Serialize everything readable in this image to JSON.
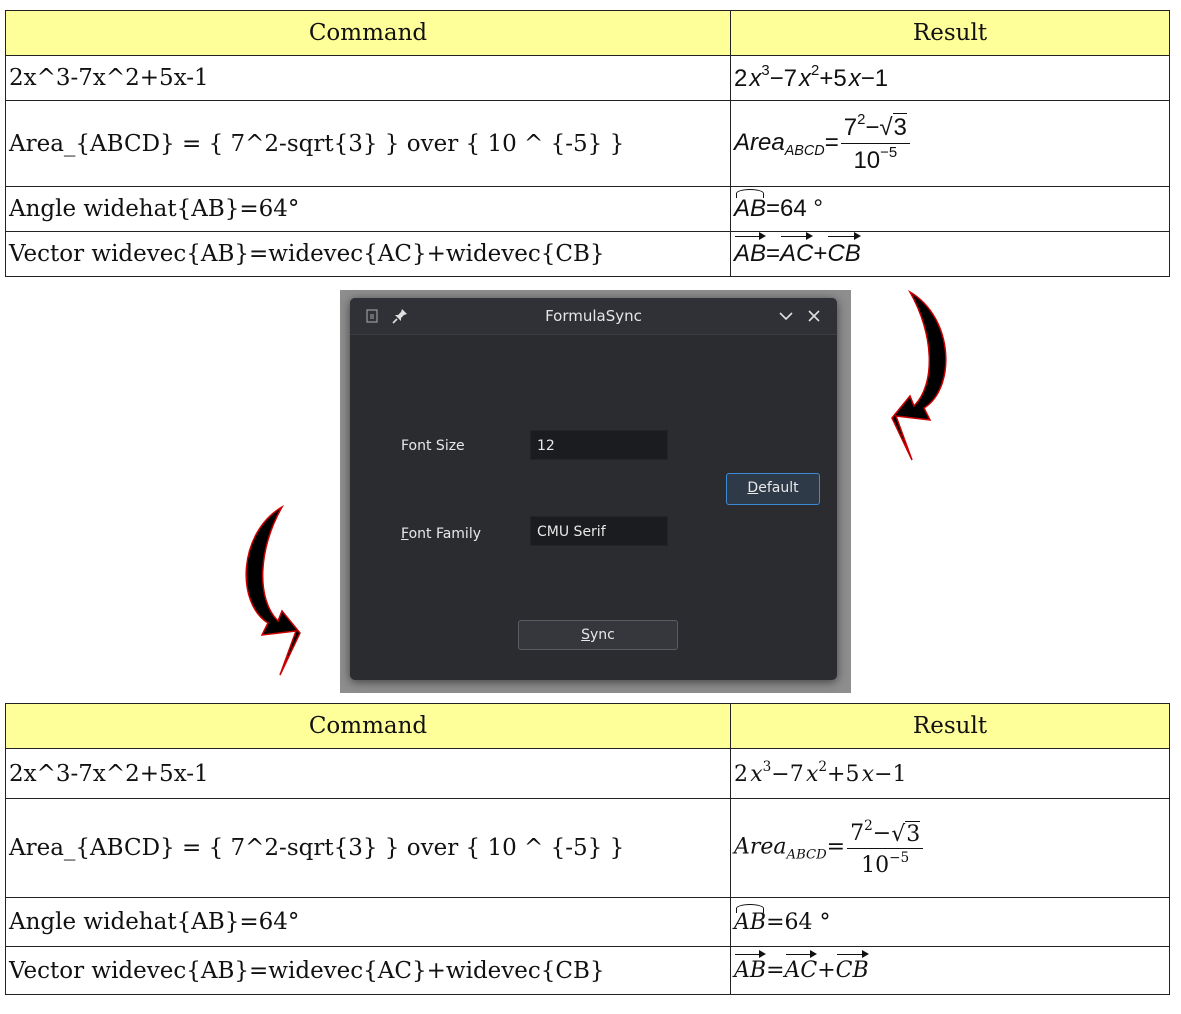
{
  "tables": {
    "header": {
      "command": "Command",
      "result": "Result"
    },
    "rows": [
      {
        "command": "2x^3-7x^2+5x-1"
      },
      {
        "command": "Area_{ABCD} = { 7^2-sqrt{3} } over { 10 ^ {-5} }"
      },
      {
        "command": "Angle widehat{AB}=64°"
      },
      {
        "command": "Vector widevec{AB}=widevec{AC}+widevec{CB}"
      }
    ],
    "results": {
      "r1": {
        "c1": "2",
        "x": "x",
        "e3": "3",
        "m7": "−7",
        "e2": "2",
        "p5": "+5",
        "m1": "−1"
      },
      "r2": {
        "area": "Area",
        "sub": "ABCD",
        "eq": "=",
        "num_base": "7",
        "num_exp": "2",
        "minus": "−",
        "rad_arg": "3",
        "den_base": "10",
        "den_exp": "−5"
      },
      "r3": {
        "arc": "AB",
        "rest": "=64 °"
      },
      "r4": {
        "ab": "AB",
        "eq": "=",
        "ac": "AC",
        "plus": "+",
        "cb": "CB"
      }
    },
    "header_bg": "#ffff99"
  },
  "dialog": {
    "title": "FormulaSync",
    "font_size_label": "Font Size",
    "font_size_value": "12",
    "font_family_label_u": "F",
    "font_family_label_rest": "ont Family",
    "font_family_value": "CMU Serif",
    "default_u": "D",
    "default_rest": "efault",
    "sync_u": "S",
    "sync_rest": "ync",
    "icons": [
      "window-menu-icon",
      "pin-icon",
      "minimize-chevron-icon",
      "close-icon"
    ],
    "accent": "#3d8bd6"
  },
  "arrows": {
    "fill": "#000000",
    "outline": "#cc0000"
  }
}
